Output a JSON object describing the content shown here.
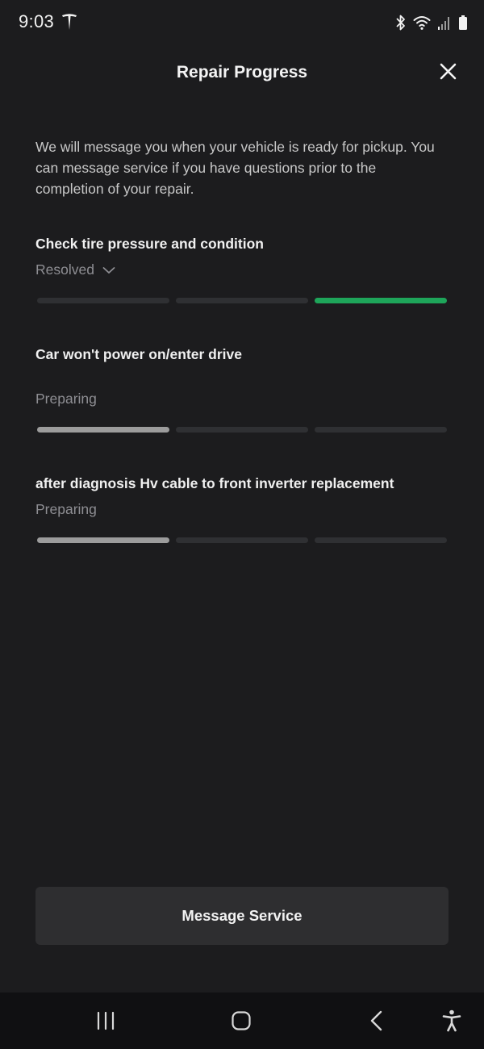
{
  "status_bar": {
    "time": "9:03",
    "icons": [
      "tesla-logo-icon",
      "bluetooth-icon",
      "wifi-icon",
      "signal-icon",
      "battery-icon"
    ]
  },
  "header": {
    "title": "Repair Progress",
    "close_icon": "close-icon"
  },
  "intro_text": "We will message you when your vehicle is ready for pickup. You can message service if you have questions prior to the completion of your repair.",
  "repair_items": [
    {
      "title": "Check tire pressure and condition",
      "status": "Resolved",
      "status_expandable": true,
      "progress_step": 3,
      "progress_total": 3,
      "progress_color": "#1ea55a"
    },
    {
      "title": "Car won't power on/enter drive",
      "status": "Preparing",
      "status_expandable": false,
      "progress_step": 1,
      "progress_total": 3,
      "progress_color": "#9c9c9c"
    },
    {
      "title": "after diagnosis Hv cable to front inverter replacement",
      "status": "Preparing",
      "status_expandable": false,
      "progress_step": 1,
      "progress_total": 3,
      "progress_color": "#9c9c9c"
    }
  ],
  "message_button": {
    "label": "Message Service"
  },
  "nav_bar": {
    "icons": [
      "recent-apps-icon",
      "home-icon",
      "back-icon",
      "accessibility-icon"
    ]
  },
  "colors": {
    "background": "#1c1c1e",
    "resolved_accent": "#1ea55a",
    "inactive_segment": "#2f3033",
    "button_background": "#2e2e30"
  }
}
